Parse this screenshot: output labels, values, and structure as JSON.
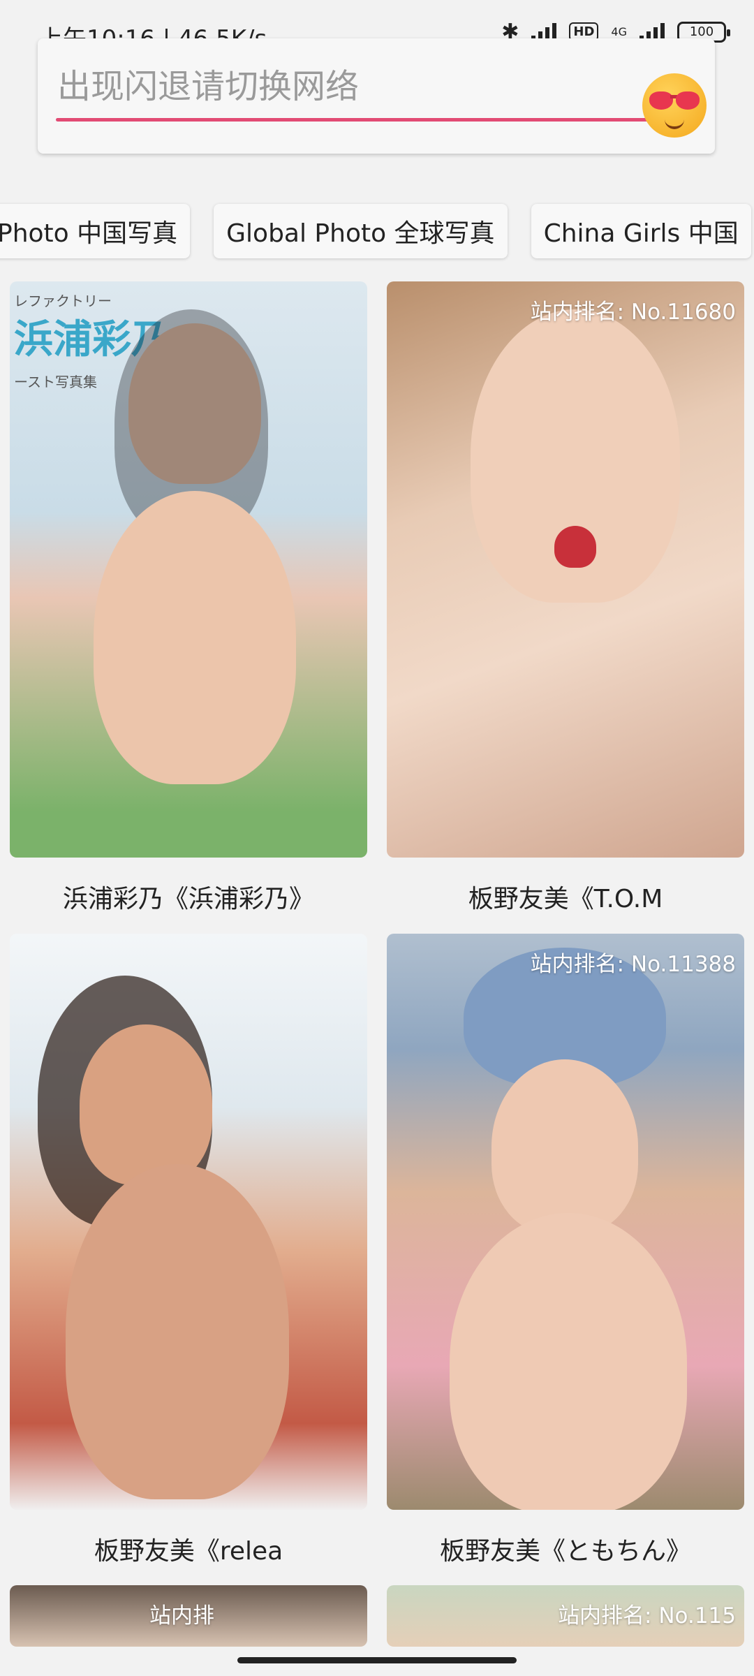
{
  "status_bar": {
    "time": "上午10:16 | 46.5K/s",
    "network": "4G",
    "battery": "100",
    "hd_label": "HD"
  },
  "search": {
    "placeholder": "出现闪退请切换网络",
    "accent_color": "#e24b74"
  },
  "categories": [
    "Photo 中国写真",
    "Global Photo 全球写真",
    "China Girls 中国"
  ],
  "cards": [
    {
      "caption": "浜浦彩乃《浜浦彩乃》",
      "rank": "",
      "cover_text": "浜浦彩乃",
      "cover_top": "レファクトリー",
      "cover_sub": "ースト写真集"
    },
    {
      "caption": "板野友美《T.O.M",
      "rank": "站内排名: No.11680"
    },
    {
      "caption": "板野友美《relea",
      "rank": ""
    },
    {
      "caption": "板野友美《ともちん》",
      "rank": "站内排名: No.11388"
    },
    {
      "caption": "",
      "rank": "站内排"
    },
    {
      "caption": "",
      "rank": "站内排名: No.115"
    }
  ]
}
